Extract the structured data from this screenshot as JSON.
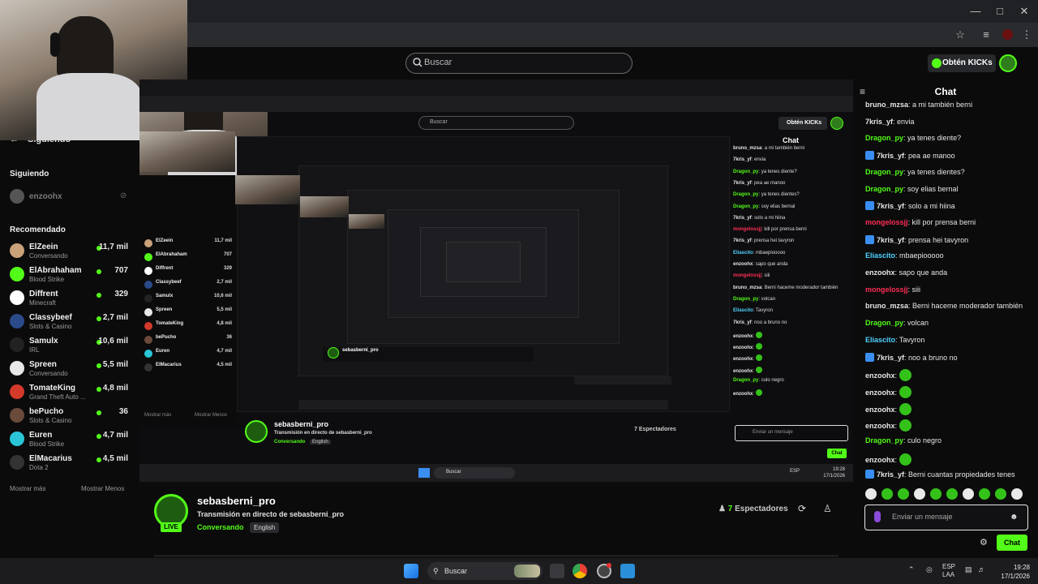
{
  "header": {
    "search_placeholder": "Buscar",
    "get_kicks_label": "Obtén KICKs"
  },
  "sidebar": {
    "following_heading": "Siguiendo",
    "top_following_heading": "Siguiendo",
    "following": [
      {
        "name": "enzoohx"
      }
    ],
    "recommended_heading": "Recomendado",
    "recommended": [
      {
        "name": "ElZeein",
        "category": "Conversando",
        "viewers": "11,7 mil",
        "color": "#c9a27a"
      },
      {
        "name": "ElAbrahaham",
        "category": "Blood Strike",
        "viewers": "707",
        "color": "#53fc18"
      },
      {
        "name": "Diffrent",
        "category": "Minecraft",
        "viewers": "329",
        "color": "#ffffff"
      },
      {
        "name": "Classybeef",
        "category": "Slots & Casino",
        "viewers": "2,7 mil",
        "color": "#2a4a8a"
      },
      {
        "name": "Samulx",
        "category": "IRL",
        "viewers": "10,6 mil",
        "color": "#222222"
      },
      {
        "name": "Spreen",
        "category": "Conversando",
        "viewers": "5,5 mil",
        "color": "#e8e8e8"
      },
      {
        "name": "TomateKing",
        "category": "Grand Theft Auto ...",
        "viewers": "4,8 mil",
        "color": "#d33a2a"
      },
      {
        "name": "bePucho",
        "category": "Slots & Casino",
        "viewers": "36",
        "color": "#6a4a3a"
      },
      {
        "name": "Euren",
        "category": "Blood Strike",
        "viewers": "4,7 mil",
        "color": "#2ac6d8"
      },
      {
        "name": "ElMacarius",
        "category": "Dota 2",
        "viewers": "4,5 mil",
        "color": "#333333"
      }
    ],
    "show_more": "Mostrar más",
    "show_less": "Mostrar Menos"
  },
  "stream": {
    "streamer": "sebasberni_pro",
    "title": "Transmisión en directo de sebasberni_pro",
    "category": "Conversando",
    "language": "English",
    "live_badge": "LIVE",
    "viewer_count": "7",
    "viewer_label": "Espectadores"
  },
  "chat": {
    "title": "Chat",
    "messages": [
      {
        "user": "bruno_mzsa",
        "text": "a mi también berni",
        "color": "#e6e6e6"
      },
      {
        "user": "7kris_yf",
        "text": "envia",
        "color": "#e6e6e6"
      },
      {
        "user": "Dragon_py",
        "text": "ya tenes diente?",
        "color": "#53fc18"
      },
      {
        "user": "7kris_yf",
        "text": "pea ae manoo",
        "color": "#e6e6e6",
        "badge": true
      },
      {
        "user": "Dragon_py",
        "text": "ya tenes dientes?",
        "color": "#53fc18"
      },
      {
        "user": "Dragon_py",
        "text": "soy elias bernal",
        "color": "#53fc18"
      },
      {
        "user": "7kris_yf",
        "text": "solo a mi hiina",
        "color": "#e6e6e6",
        "badge": true
      },
      {
        "user": "mongelossjj",
        "text": "kill por prensa berni",
        "color": "#ff2d55"
      },
      {
        "user": "7kris_yf",
        "text": "prensa hei tavyron",
        "color": "#e6e6e6",
        "badge": true
      },
      {
        "user": "Eliascito",
        "text": "mbaepiooooo",
        "color": "#4fd2ff"
      },
      {
        "user": "enzoohx",
        "text": "sapo que anda",
        "color": "#e6e6e6"
      },
      {
        "user": "mongelossjj",
        "text": "siii",
        "color": "#ff2d55"
      },
      {
        "user": "bruno_mzsa",
        "text": "Berni haceme moderador también",
        "color": "#e6e6e6"
      },
      {
        "user": "Dragon_py",
        "text": "volcan",
        "color": "#53fc18"
      },
      {
        "user": "Eliascito",
        "text": "Tavyron",
        "color": "#4fd2ff"
      },
      {
        "user": "7kris_yf",
        "text": "noo a bruno no",
        "color": "#e6e6e6",
        "badge": true
      },
      {
        "user": "enzoohx",
        "text": "",
        "color": "#e6e6e6",
        "emote": true
      },
      {
        "user": "enzoohx",
        "text": "",
        "color": "#e6e6e6",
        "emote": true
      },
      {
        "user": "enzoohx",
        "text": "",
        "color": "#e6e6e6",
        "emote": true
      },
      {
        "user": "enzoohx",
        "text": "",
        "color": "#e6e6e6",
        "emote": true
      },
      {
        "user": "Dragon_py",
        "text": "culo negro",
        "color": "#53fc18"
      },
      {
        "user": "enzoohx",
        "text": "",
        "color": "#e6e6e6",
        "emote": true
      },
      {
        "user": "7kris_yf",
        "text": "Berni cuantas propiedades tenes",
        "color": "#e6e6e6",
        "badge": true
      }
    ],
    "input_placeholder": "Enviar un mensaje",
    "send_label": "Chat"
  },
  "inner": {
    "search": "Buscar",
    "get_kicks": "Obtén KICKs",
    "chat_title": "Chat",
    "streamer": "sebasberni_pro",
    "title": "Transmisión en directo de sebasberni_pro",
    "category": "Conversando",
    "language": "English",
    "viewers": "7 Espectadores",
    "input_placeholder": "Enviar un mensaje",
    "send_label": "Chat",
    "taskbar_search": "Buscar",
    "lang": "ESP",
    "clock_time": "19:28",
    "clock_date": "17/1/2026"
  },
  "taskbar": {
    "search": "Buscar",
    "lang_line1": "ESP",
    "lang_line2": "LAA",
    "time": "19:28",
    "date": "17/1/2026"
  },
  "colors": {
    "accent": "#53fc18",
    "background": "#0b0b0c"
  }
}
